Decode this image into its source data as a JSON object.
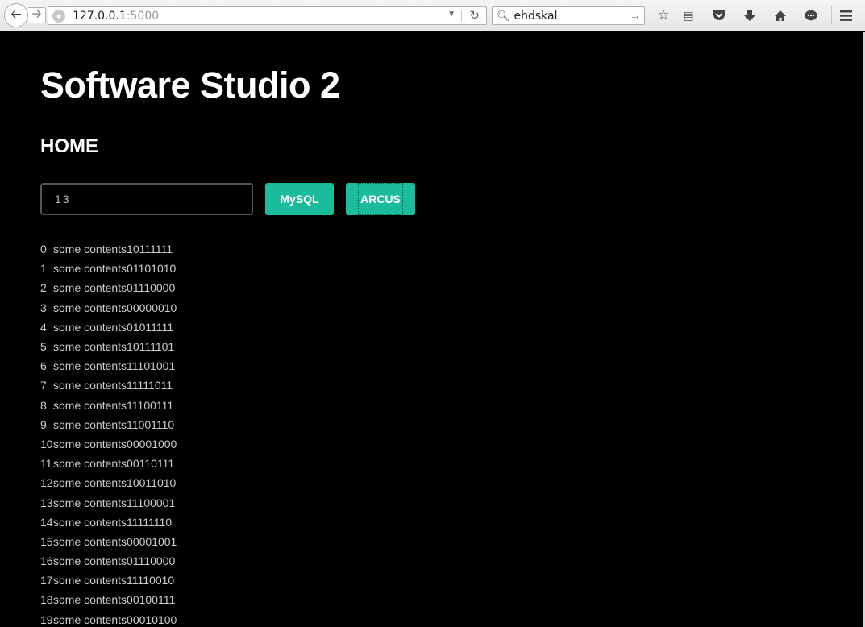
{
  "browser": {
    "url_host": "127.0.0.1",
    "url_port": ":5000",
    "search_query": "ehdskal",
    "icons": [
      "back-arrow-icon",
      "forward-arrow-icon",
      "globe-icon",
      "dropdown-icon",
      "reload-icon",
      "search-icon",
      "go-arrow-icon",
      "star-icon",
      "reading-list-icon",
      "pocket-icon",
      "download-icon",
      "home-icon",
      "chat-icon",
      "menu-icon"
    ]
  },
  "page": {
    "title": "Software Studio 2",
    "subtitle": "HOME",
    "input_value": "13",
    "buttons": {
      "mysql": "MySQL",
      "arcus": "ARCUS"
    },
    "accent_color": "#1abc9c",
    "results": [
      {
        "index": "0",
        "content": "some contents10111111"
      },
      {
        "index": "1",
        "content": "some contents01101010"
      },
      {
        "index": "2",
        "content": "some contents01110000"
      },
      {
        "index": "3",
        "content": "some contents00000010"
      },
      {
        "index": "4",
        "content": "some contents01011111"
      },
      {
        "index": "5",
        "content": "some contents10111101"
      },
      {
        "index": "6",
        "content": "some contents11101001"
      },
      {
        "index": "7",
        "content": "some contents11111011"
      },
      {
        "index": "8",
        "content": "some contents11100111"
      },
      {
        "index": "9",
        "content": "some contents11001110"
      },
      {
        "index": "10",
        "content": "some contents00001000"
      },
      {
        "index": "11",
        "content": "some contents00110111"
      },
      {
        "index": "12",
        "content": "some contents10011010"
      },
      {
        "index": "13",
        "content": "some contents11100001"
      },
      {
        "index": "14",
        "content": "some contents11111110"
      },
      {
        "index": "15",
        "content": "some contents00001001"
      },
      {
        "index": "16",
        "content": "some contents01110000"
      },
      {
        "index": "17",
        "content": "some contents11110010"
      },
      {
        "index": "18",
        "content": "some contents00100111"
      },
      {
        "index": "19",
        "content": "some contents00010100"
      }
    ]
  }
}
